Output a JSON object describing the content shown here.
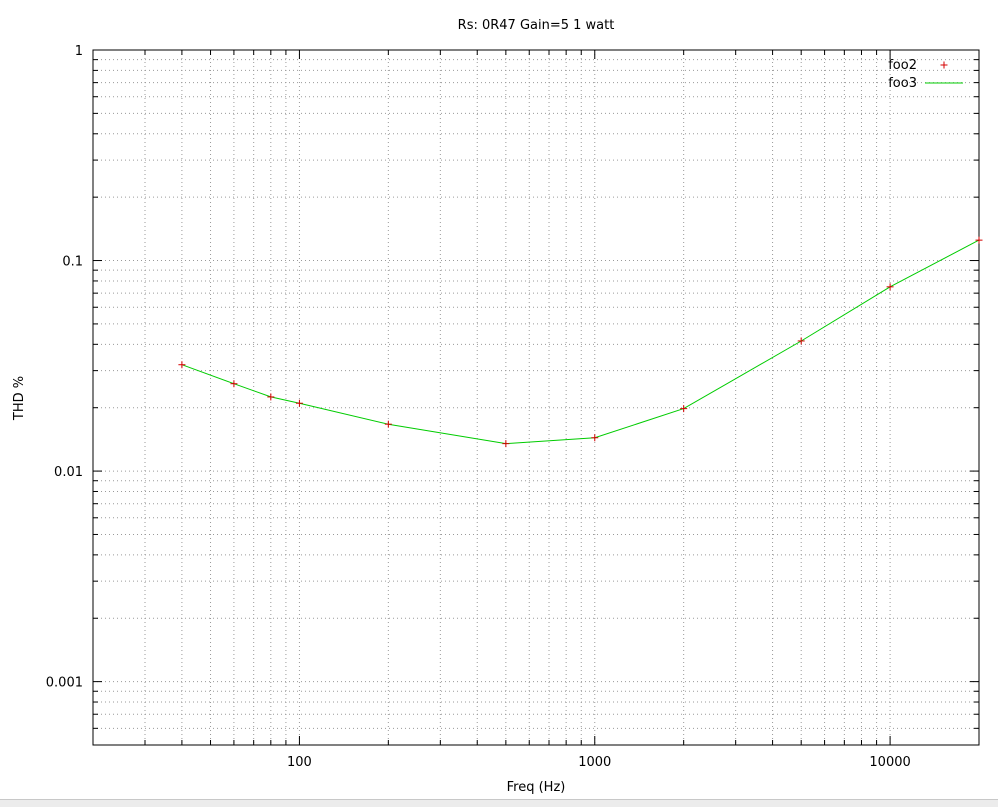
{
  "chart_data": {
    "type": "line",
    "title": "Rs: 0R47  Gain=5 1 watt",
    "xlabel": "Freq (Hz)",
    "ylabel": "THD %",
    "xscale": "log",
    "yscale": "log",
    "xlim": [
      20,
      20000
    ],
    "ylim": [
      0.0005,
      1
    ],
    "x_ticks": [
      {
        "value": 100,
        "label": "100"
      },
      {
        "value": 1000,
        "label": "1000"
      },
      {
        "value": 10000,
        "label": "10000"
      }
    ],
    "y_ticks": [
      {
        "value": 0.001,
        "label": "0.001"
      },
      {
        "value": 0.01,
        "label": "0.01"
      },
      {
        "value": 0.1,
        "label": "0.1"
      },
      {
        "value": 1,
        "label": "1"
      }
    ],
    "grid": true,
    "legend_position": "top-right",
    "series": [
      {
        "name": "foo2",
        "style": "points",
        "color": "#d40000",
        "x": [
          40,
          60,
          80,
          100,
          200,
          500,
          1000,
          2000,
          5000,
          10000,
          20000
        ],
        "y": [
          0.032,
          0.026,
          0.0225,
          0.021,
          0.0167,
          0.0135,
          0.0144,
          0.0198,
          0.0415,
          0.075,
          0.125
        ]
      },
      {
        "name": "foo3",
        "style": "line",
        "color": "#00cc00",
        "x": [
          40,
          60,
          80,
          100,
          200,
          500,
          1000,
          2000,
          5000,
          10000,
          20000
        ],
        "y": [
          0.032,
          0.026,
          0.0225,
          0.021,
          0.0167,
          0.0135,
          0.0144,
          0.0198,
          0.0415,
          0.075,
          0.125
        ]
      }
    ]
  }
}
